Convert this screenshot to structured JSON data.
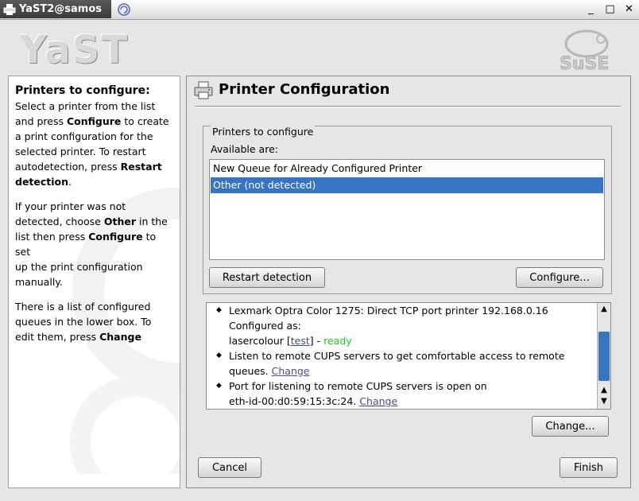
{
  "window": {
    "title": "YaST2@samos"
  },
  "header": {
    "logo_text": "YaST",
    "brand_text": "SuSE"
  },
  "help": {
    "heading": "Printers to configure:",
    "p1": [
      "Select a printer from the list",
      "and press ",
      "Configure",
      " to create",
      "a print configuration for the",
      "selected printer. To restart",
      "autodetection, press ",
      "Restart",
      "detection",
      "."
    ],
    "p2": [
      "If your printer was not",
      "detected, choose ",
      "Other",
      " in the",
      "list then press ",
      "Configure",
      " to set",
      "up the print configuration",
      "manually."
    ],
    "p3": [
      "There is a list of configured",
      "queues in the lower box. To",
      "edit them, press ",
      "Change"
    ]
  },
  "main": {
    "title": "Printer Configuration",
    "group_label": "Printers to configure",
    "available_label": "Available are:",
    "printers": [
      {
        "label": "New Queue for Already Configured Printer",
        "selected": false
      },
      {
        "label": "Other (not detected)",
        "selected": true
      }
    ],
    "restart_button": "Restart detection",
    "configure_button": "Configure...",
    "info": {
      "item1_line1": "Lexmark Optra Color 1275: Direct TCP port printer 192.168.0.16",
      "item1_line2": "Configured as:",
      "queue_name": "lasercolour",
      "test_link": "test",
      "status": "ready",
      "item2_line1": "Listen to remote CUPS servers to get comfortable access to remote",
      "item2_line2": "queues.",
      "change_link": "Change",
      "item3_line1": "Port for listening to remote CUPS servers is open on",
      "item3_line2": "eth-id-00:d0:59:15:3c:24."
    },
    "change_button": "Change...",
    "cancel_button": "Cancel",
    "finish_button": "Finish"
  }
}
